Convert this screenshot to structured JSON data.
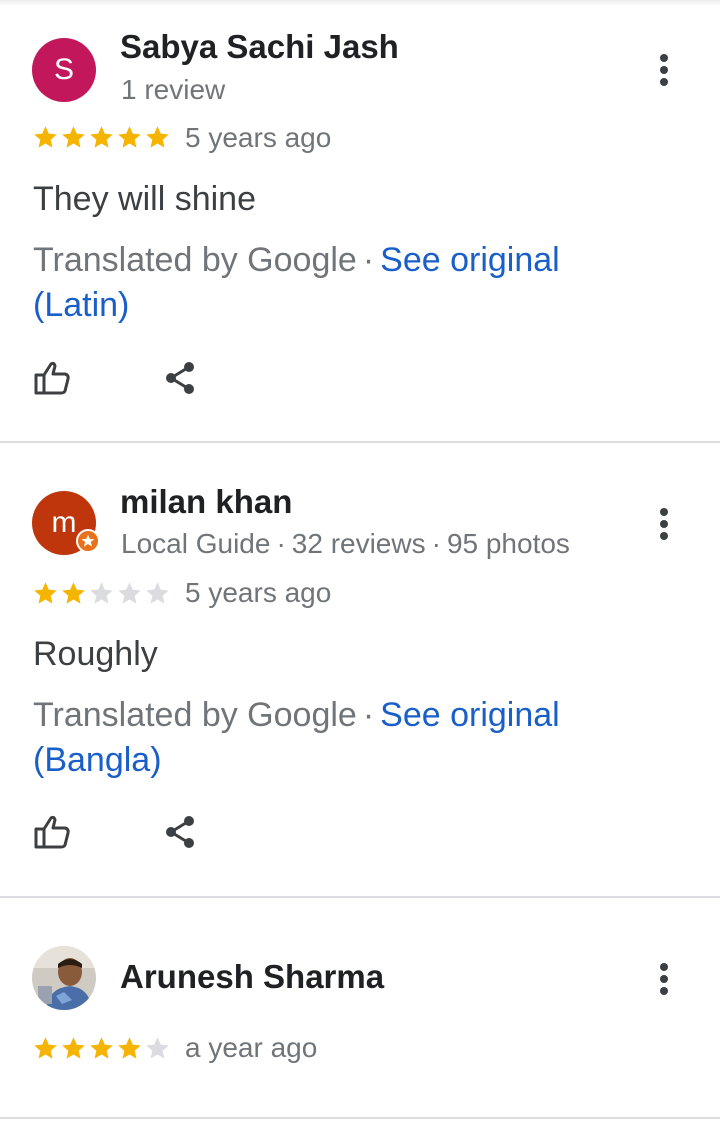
{
  "reviews": [
    {
      "avatar_letter": "S",
      "avatar_color": "#c2185b",
      "author": "Sabya Sachi Jash",
      "meta": [
        "1 review"
      ],
      "rating": 5,
      "time": "5 years ago",
      "text": "They will shine",
      "translated_prefix": "Translated by Google",
      "see_original": "See original",
      "original_language": "(Latin)"
    },
    {
      "avatar_letter": "m",
      "avatar_color": "#bf360c",
      "local_guide": true,
      "author": "milan khan",
      "meta": [
        "Local Guide",
        "32 reviews",
        "95 photos"
      ],
      "rating": 2,
      "time": "5 years ago",
      "text": "Roughly",
      "translated_prefix": "Translated by Google",
      "see_original": "See original",
      "original_language": "(Bangla)"
    },
    {
      "avatar_photo": true,
      "author": "Arunesh Sharma",
      "rating": 4,
      "time": "a year ago"
    }
  ],
  "icons": {
    "like": "thumbs-up-icon",
    "share": "share-icon",
    "menu": "more-vert-icon"
  },
  "colors": {
    "star_filled": "#f4b400",
    "star_empty": "#dadce0",
    "link": "#1a5fc9"
  }
}
